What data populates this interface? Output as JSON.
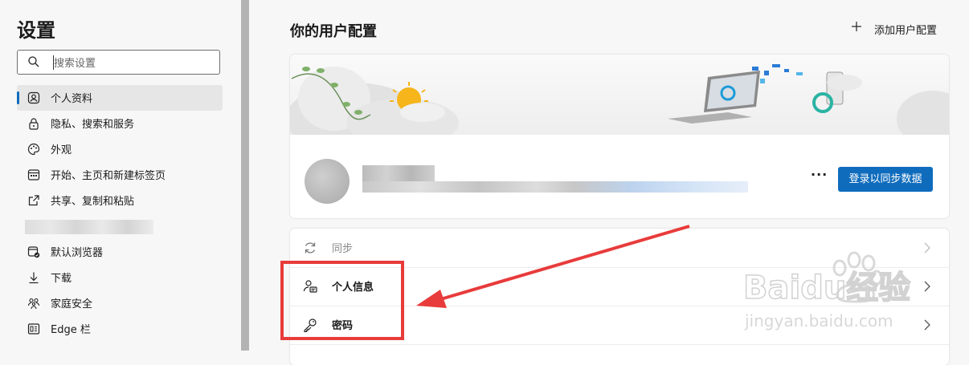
{
  "sidebar": {
    "title": "设置",
    "search_placeholder": "搜索设置",
    "items": [
      {
        "label": "个人资料",
        "icon": "profile-icon",
        "active": true
      },
      {
        "label": "隐私、搜索和服务",
        "icon": "lock-icon"
      },
      {
        "label": "外观",
        "icon": "palette-icon"
      },
      {
        "label": "开始、主页和新建标签页",
        "icon": "start-page-icon"
      },
      {
        "label": "共享、复制和粘贴",
        "icon": "share-icon"
      },
      {
        "label": "",
        "icon": "blurred"
      },
      {
        "label": "默认浏览器",
        "icon": "browser-icon"
      },
      {
        "label": "下载",
        "icon": "download-icon"
      },
      {
        "label": "家庭安全",
        "icon": "family-icon"
      },
      {
        "label": "Edge 栏",
        "icon": "edge-bar-icon"
      }
    ]
  },
  "main": {
    "title": "你的用户配置",
    "add_profile_label": "添加用户配置",
    "profile_card": {
      "more_label": "···",
      "sign_in_label": "登录以同步数据"
    },
    "settings_rows": [
      {
        "label": "同步",
        "icon": "sync-icon",
        "disabled": true
      },
      {
        "label": "个人信息",
        "icon": "personal-info-icon",
        "disabled": false
      },
      {
        "label": "密码",
        "icon": "key-icon",
        "disabled": false
      }
    ]
  },
  "watermark": {
    "brand": "Baidu经验",
    "url": "jingyan.baidu.com"
  },
  "colors": {
    "accent": "#0f6cbd",
    "highlight": "#e83b3b"
  }
}
